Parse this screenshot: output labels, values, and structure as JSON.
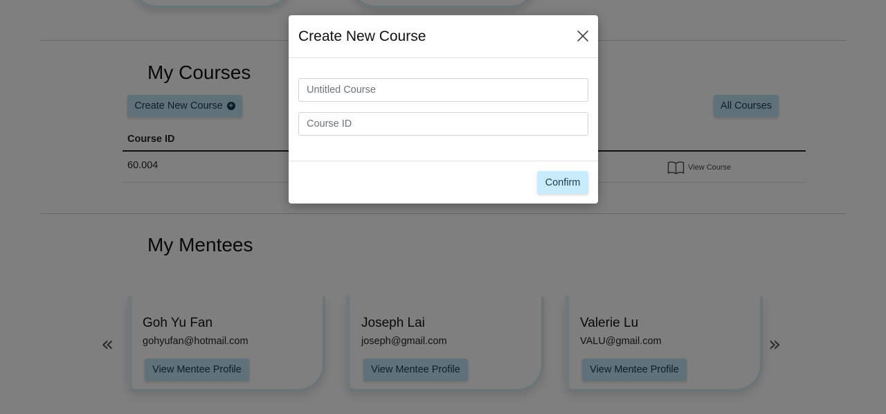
{
  "courses_section": {
    "title": "My Courses",
    "create_button_label": "Create New Course",
    "all_courses_button_label": "All Courses",
    "table": {
      "columns": [
        "Course ID"
      ],
      "rows": [
        {
          "course_id": "60.004",
          "action_label": "View Course"
        }
      ]
    }
  },
  "mentees_section": {
    "title": "My Mentees",
    "mentees": [
      {
        "name": "Goh Yu Fan",
        "email": "gohyufan@hotmail.com",
        "button_label": "View Mentee Profile"
      },
      {
        "name": "Joseph Lai",
        "email": "joseph@gmail.com",
        "button_label": "View Mentee Profile"
      },
      {
        "name": "Valerie Lu",
        "email": "VALU@gmail.com",
        "button_label": "View Mentee Profile"
      }
    ],
    "prev_icon": "double-chevron-left-icon",
    "next_icon": "double-chevron-right-icon"
  },
  "modal": {
    "title": "Create New Course",
    "course_name_placeholder": "Untitled Course",
    "course_id_placeholder": "Course ID",
    "confirm_label": "Confirm",
    "close_icon": "close-icon"
  },
  "colors": {
    "accent_button": "#bfe3f3",
    "confirm_button": "#c8ecfb",
    "overlay": "rgba(0,0,0,0.5)"
  }
}
